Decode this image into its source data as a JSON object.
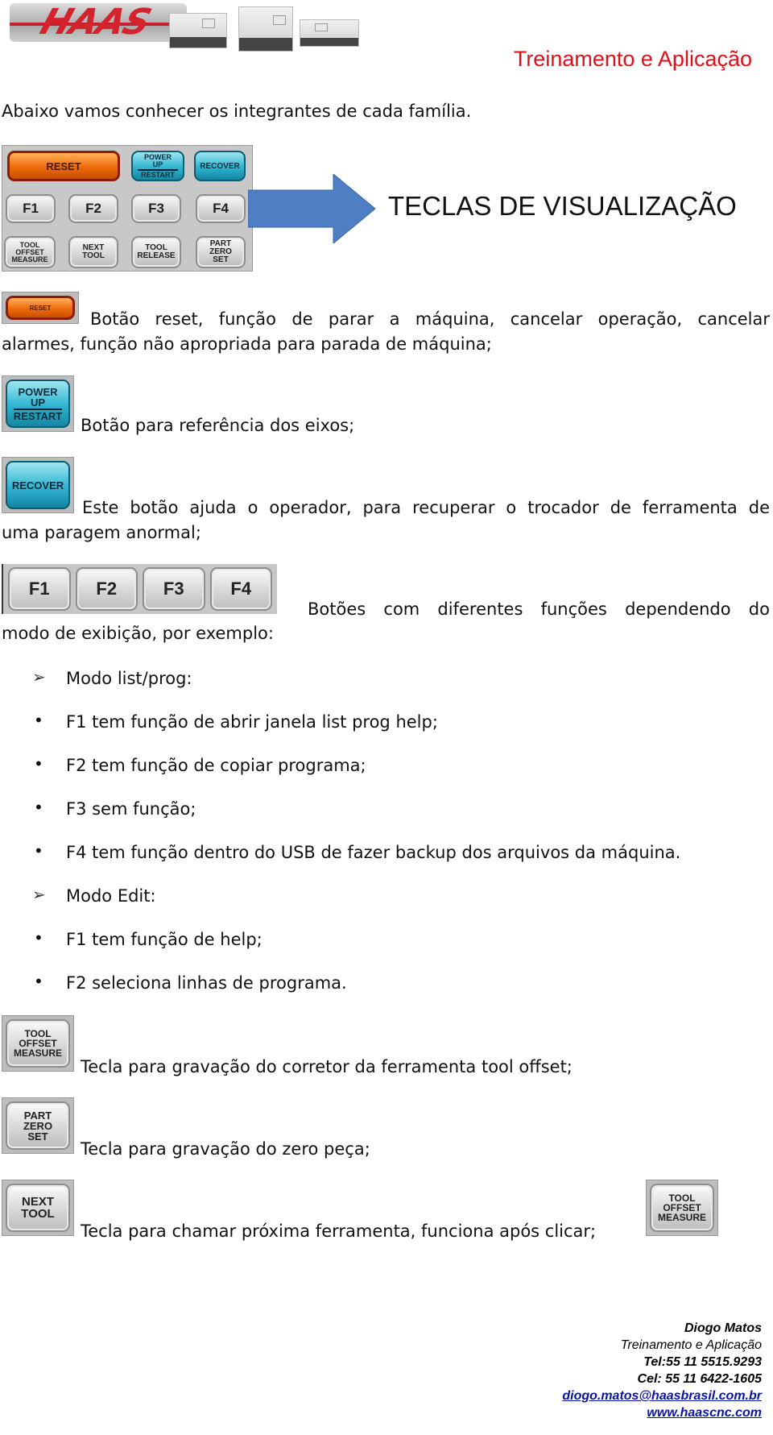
{
  "header": {
    "logo_text": "HAAS",
    "title": "Treinamento e Aplicação",
    "accent_color": "#e0101a"
  },
  "intro": "Abaixo vamos conhecer os integrantes de cada família.",
  "keypad": {
    "reset": "RESET",
    "power_up": [
      "POWER",
      "UP",
      "RESTART"
    ],
    "recover": "RECOVER",
    "f_keys": [
      "F1",
      "F2",
      "F3",
      "F4"
    ],
    "tool_offset": [
      "TOOL",
      "OFFSET",
      "MEASURE"
    ],
    "next_tool": [
      "NEXT",
      "TOOL"
    ],
    "tool_release": [
      "TOOL",
      "RELEASE"
    ],
    "part_zero": [
      "PART",
      "ZERO",
      "SET"
    ]
  },
  "arrow_label": "TECLAS DE VISUALIZAÇÃO",
  "sections": {
    "reset_line1": "Botão reset, função de parar a máquina, cancelar operação, cancelar",
    "reset_line2": "alarmes, função não apropriada para parada de máquina;",
    "power_up": "Botão para referência dos eixos;",
    "recover_line1": "Este botão ajuda o operador, para recuperar o trocador de ferramenta de",
    "recover_line2": "uma paragem anormal;",
    "fkeys_line1": "Botões com diferentes funções dependendo do",
    "fkeys_line2": "modo de exibição, por exemplo:",
    "tool_offset": "Tecla para gravação do corretor da ferramenta tool offset;",
    "part_zero": "Tecla para gravação do zero peça;",
    "next_tool": "Tecla para chamar próxima ferramenta, funciona após clicar;"
  },
  "modes": [
    {
      "title": "Modo list/prog:",
      "items": [
        "F1 tem função de abrir janela list prog help;",
        "F2 tem função de copiar programa;",
        "F3 sem função;",
        "F4 tem função dentro do USB de fazer backup dos arquivos da máquina."
      ]
    },
    {
      "title": "Modo Edit:",
      "items": [
        "F1 tem função de help;",
        "F2 seleciona linhas de programa."
      ]
    }
  ],
  "footer": {
    "name": "Diogo Matos",
    "role": "Treinamento e Aplicação",
    "tel": "Tel:55 11 5515.9293",
    "cel": "Cel: 55 11 6422-1605",
    "email": "diogo.matos@haasbrasil.com.br",
    "website": "www.haascnc.com",
    "link_color": "#0a13a8"
  }
}
